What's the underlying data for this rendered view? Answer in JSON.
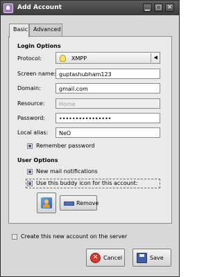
{
  "window": {
    "title": "Add Account",
    "controls": {
      "minimize": "▁",
      "maximize": "▢",
      "close": "✕"
    }
  },
  "tabs": [
    {
      "label": "Basic",
      "active": true
    },
    {
      "label": "Advanced",
      "active": false
    }
  ],
  "login_options": {
    "heading": "Login Options",
    "protocol_label": "Protocol:",
    "protocol_value": "XMPP",
    "screen_name_label": "Screen name:",
    "screen_name_value": "guptashubham123",
    "domain_label": "Domain:",
    "domain_value": "gmail.com",
    "resource_label": "Resource:",
    "resource_value": "Home",
    "password_label": "Password:",
    "password_value": "••••••••••••••••",
    "local_alias_label": "Local alias:",
    "local_alias_value": "NeO",
    "remember_password_label": "Remember password",
    "remember_password_checked": true
  },
  "user_options": {
    "heading": "User Options",
    "new_mail_label": "New mail notifications",
    "new_mail_checked": true,
    "buddy_icon_label": "Use this buddy icon for this account:",
    "buddy_icon_checked": true,
    "remove_label": "Remove"
  },
  "create_on_server_label": "Create this new account on the server",
  "create_on_server_checked": false,
  "buttons": {
    "cancel": "Cancel",
    "save": "Save"
  },
  "colors": {
    "titlebar": "#3f3f3f",
    "dialog_bg": "#d8d8d8",
    "panel_bg": "#eaeaea",
    "accent": "#4e5b8a"
  }
}
